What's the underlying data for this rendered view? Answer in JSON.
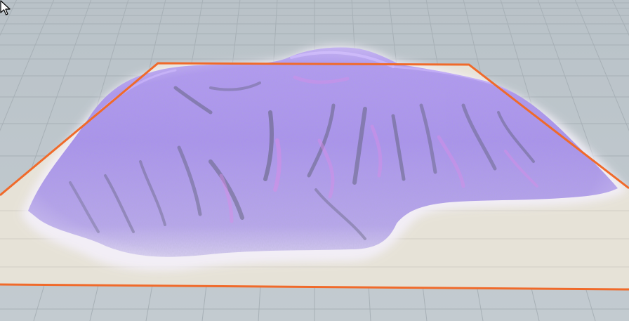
{
  "viewport": {
    "kind": "3d-terrain-viewport",
    "background_color": "#b9c2c8",
    "grid_line_color": "#a7b0b6",
    "ground_plane_color": "#e7e3d8",
    "selection_outline_color": "#f06a2a",
    "terrain_colors": {
      "base": "#a98ff0",
      "highlight": "#c9a9ff",
      "magenta_accent": "#d58ae8",
      "shadow": "#6a6c86",
      "edge_mist": "#f2eef8"
    },
    "grid": true,
    "terrain_selected": true
  },
  "cursor": {
    "icon": "arrow-pointer-icon"
  }
}
